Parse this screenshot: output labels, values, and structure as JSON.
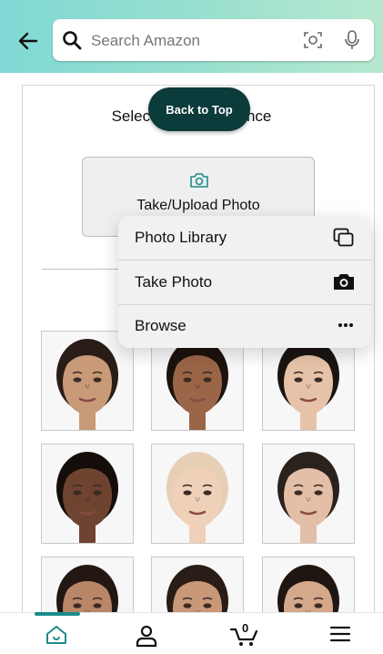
{
  "header": {
    "search_placeholder": "Search Amazon"
  },
  "page": {
    "title": "Select Your Experience",
    "back_to_top": "Back to Top",
    "upload_button": "Take/Upload Photo"
  },
  "menu": {
    "items": [
      {
        "label": "Photo Library",
        "icon": "photo-library-icon"
      },
      {
        "label": "Take Photo",
        "icon": "camera-icon"
      },
      {
        "label": "Browse",
        "icon": "more-icon"
      }
    ]
  },
  "faces": [
    {
      "skin": "#c89a78",
      "hair": "#2a1c16"
    },
    {
      "skin": "#9b6547",
      "hair": "#1c120e"
    },
    {
      "skin": "#e6c3a8",
      "hair": "#1a1412"
    },
    {
      "skin": "#6e4330",
      "hair": "#140d0a"
    },
    {
      "skin": "#efd0b8",
      "hair": "#e7cfb6"
    },
    {
      "skin": "#e3bfa7",
      "hair": "#2b211d"
    },
    {
      "skin": "#b98668",
      "hair": "#231713"
    },
    {
      "skin": "#c99879",
      "hair": "#2a1d17"
    },
    {
      "skin": "#d4a88b",
      "hair": "#1f1511"
    }
  ],
  "bottom_nav": {
    "cart_count": "0",
    "items": [
      "home-icon",
      "account-icon",
      "cart-icon",
      "menu-icon"
    ]
  },
  "colors": {
    "header_accent": "#80d8d5",
    "back_to_top_bg": "#0b3b3a",
    "nav_indicator": "#1a8c8c",
    "camera_icon": "#1a8c8c"
  }
}
